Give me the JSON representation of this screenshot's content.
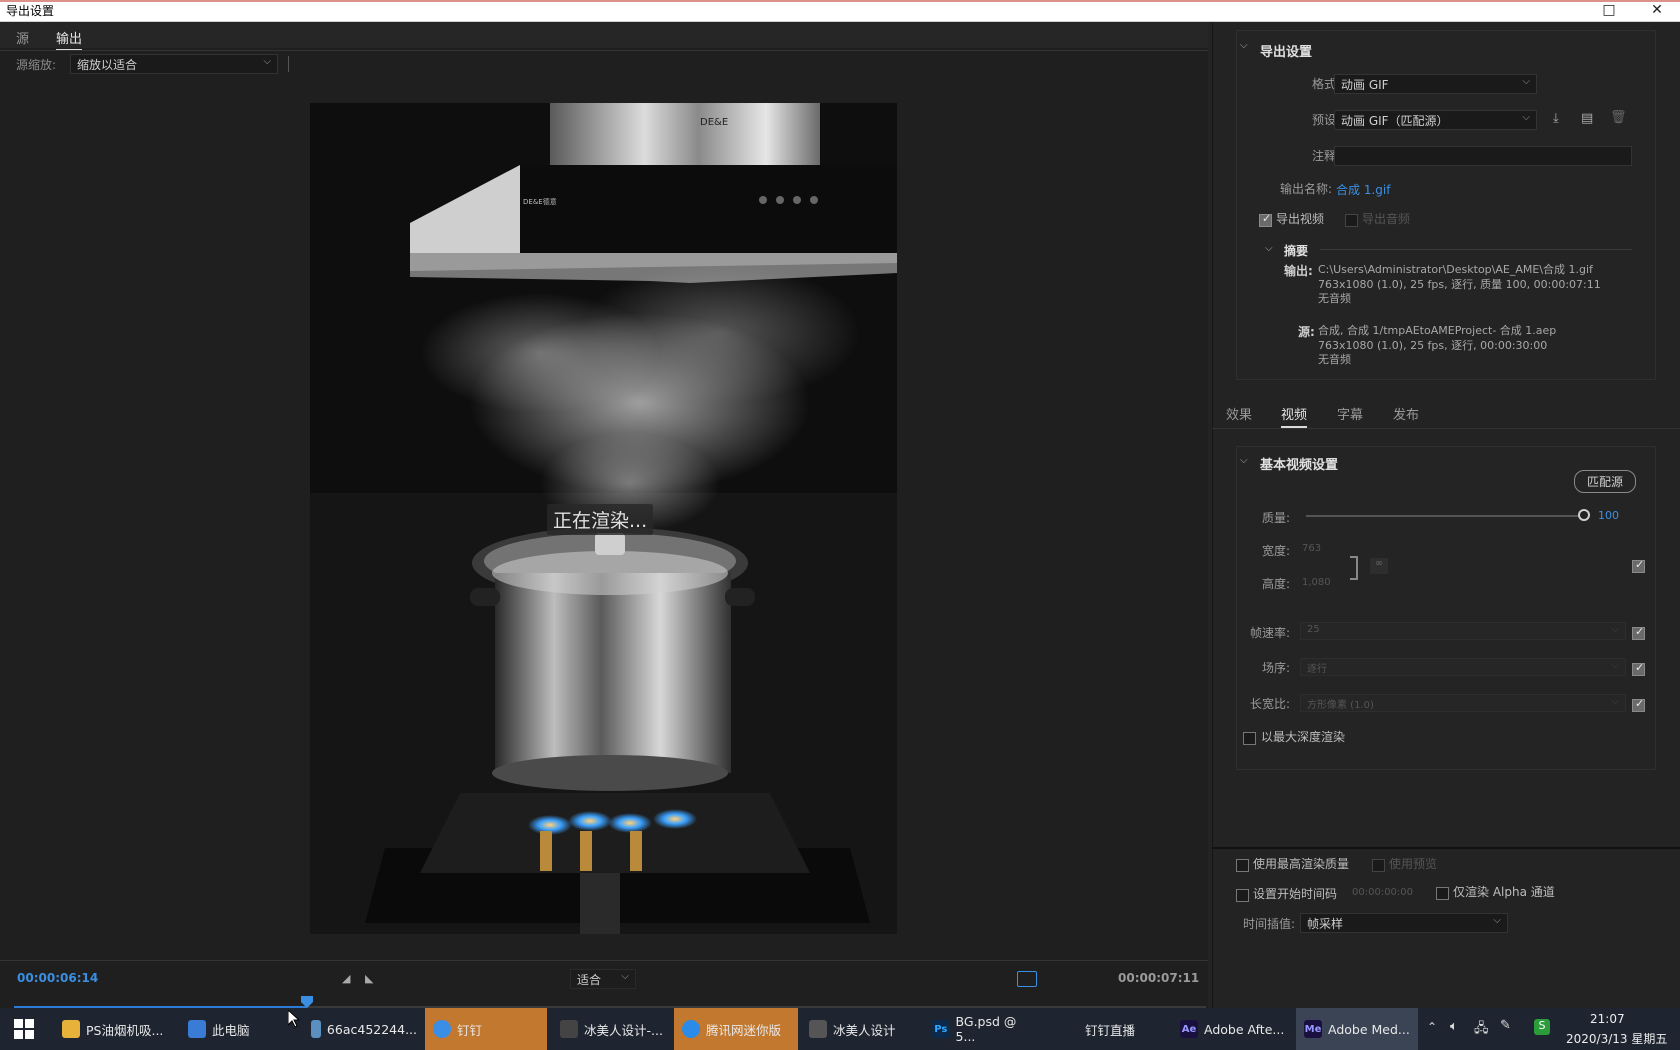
{
  "window": {
    "title": "导出设置",
    "restore_label": "□",
    "close_label": "✕"
  },
  "left": {
    "tabs": [
      "源",
      "输出"
    ],
    "zoom_label": "源缩放:",
    "zoom_value": "缩放以适合",
    "render_message": "正在渲染...",
    "hood_brand": "DE&E",
    "hood_panel_brand": "DE&E德意",
    "timecode_current": "00:00:06:14",
    "timecode_total": "00:00:07:11",
    "fit_value": "适合",
    "scrub_progress": 0.246
  },
  "export_settings": {
    "section_title": "导出设置",
    "format_label": "格式:",
    "format_value": "动画 GIF",
    "preset_label": "预设:",
    "preset_value": "动画 GIF（匹配源）",
    "comment_label": "注释:",
    "comment_value": "",
    "output_name_label": "输出名称:",
    "output_name_value": "合成 1.gif",
    "export_video_label": "导出视频",
    "export_video_checked": true,
    "export_audio_label": "导出音频",
    "export_audio_checked": false,
    "summary_title": "摘要",
    "summary_output_label": "输出:",
    "summary_output_lines": [
      "C:\\Users\\Administrator\\Desktop\\AE_AME\\合成 1.gif",
      "763x1080 (1.0), 25 fps, 逐行, 质量 100, 00:00:07:11",
      "无音频"
    ],
    "summary_source_label": "源:",
    "summary_source_lines": [
      "合成, 合成 1/tmpAEtoAMEProject- 合成 1.aep",
      "763x1080 (1.0), 25 fps, 逐行, 00:00:30:00",
      "无音频"
    ]
  },
  "sub_tabs": [
    "效果",
    "视频",
    "字幕",
    "发布"
  ],
  "video_settings": {
    "section_title": "基本视频设置",
    "match_source_label": "匹配源",
    "quality_label": "质量:",
    "quality_value": "100",
    "quality_level": 1.0,
    "width_label": "宽度:",
    "width_value": "763",
    "height_label": "高度:",
    "height_value": "1,080",
    "frame_rate_label": "帧速率:",
    "frame_rate_value": "25",
    "field_order_label": "场序:",
    "field_order_value": "逐行",
    "aspect_label": "长宽比:",
    "aspect_value": "方形像素 (1.0)",
    "max_depth_label": "以最大深度渲染"
  },
  "bottom_options": {
    "max_quality_label": "使用最高渲染质量",
    "use_preview_label": "使用预览",
    "set_start_tc_label": "设置开始时间码",
    "start_tc_value": "00:00:00:00",
    "alpha_only_label": "仅渲染 Alpha 通道",
    "interp_label": "时间插值:",
    "interp_value": "帧采样"
  },
  "taskbar": {
    "items": [
      {
        "label": "PS油烟机吸...",
        "icon": "folder-icon"
      },
      {
        "label": "此电脑",
        "icon": "computer-icon"
      },
      {
        "label": "66ac452244...",
        "icon": "image-icon"
      },
      {
        "label": "钉钉",
        "icon": "dingtalk-icon"
      },
      {
        "label": "冰美人设计-...",
        "icon": "app-icon"
      },
      {
        "label": "腾讯网迷你版",
        "icon": "tencent-icon"
      },
      {
        "label": "冰美人设计",
        "icon": "app-icon"
      },
      {
        "label": "BG.psd @ 5...",
        "icon": "photoshop-icon"
      },
      {
        "label": "钉钉直播",
        "icon": "dingtalk-live-icon"
      },
      {
        "label": "Adobe Afte...",
        "icon": "after-effects-icon"
      },
      {
        "label": "Adobe Med...",
        "icon": "media-encoder-icon"
      }
    ],
    "time": "21:07",
    "date": "2020/3/13 星期五",
    "ime": "S"
  }
}
